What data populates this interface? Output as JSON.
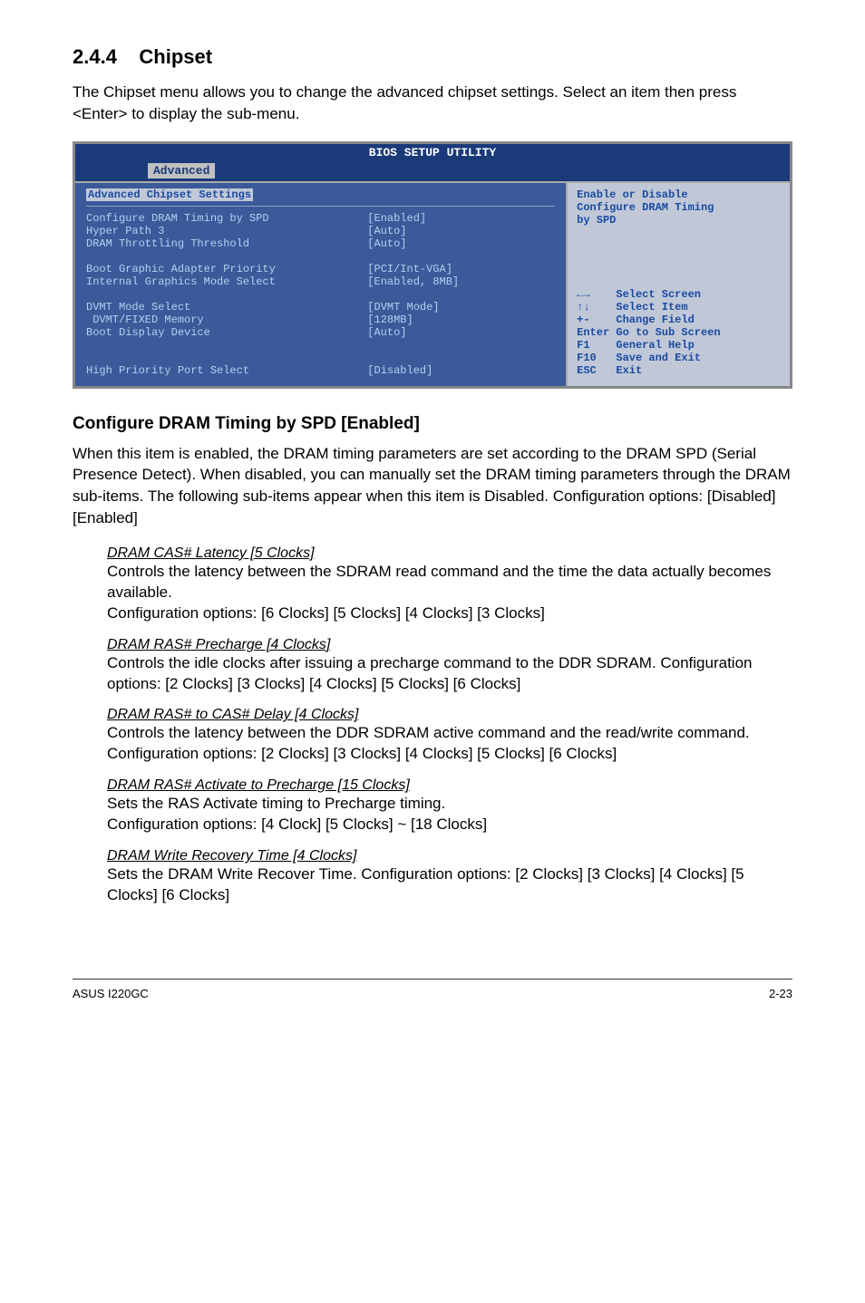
{
  "section": {
    "number": "2.4.4",
    "title": "Chipset",
    "description": "The Chipset menu allows you to change the advanced chipset settings. Select an item then press <Enter> to display the sub-menu."
  },
  "bios": {
    "title": "BIOS SETUP UTILITY",
    "activeTab": "Advanced",
    "panelHeading": "Advanced Chipset Settings",
    "rows": [
      {
        "label": "Configure DRAM Timing by SPD",
        "value": "[Enabled]"
      },
      {
        "label": "Hyper Path 3",
        "value": "[Auto]"
      },
      {
        "label": "DRAM Throttling Threshold",
        "value": "[Auto]"
      },
      {
        "label": "",
        "value": ""
      },
      {
        "label": "Boot Graphic Adapter Priority",
        "value": "[PCI/Int-VGA]"
      },
      {
        "label": "Internal Graphics Mode Select",
        "value": "[Enabled, 8MB]"
      },
      {
        "label": "",
        "value": ""
      },
      {
        "label": "DVMT Mode Select",
        "value": "[DVMT Mode]"
      },
      {
        "label": " DVMT/FIXED Memory",
        "value": "[128MB]"
      },
      {
        "label": "Boot Display Device",
        "value": "[Auto]"
      },
      {
        "label": "",
        "value": ""
      },
      {
        "label": "",
        "value": ""
      },
      {
        "label": "High Priority Port Select",
        "value": "[Disabled]"
      }
    ],
    "helpTop": {
      "line1": "Enable or Disable",
      "line2": "Configure DRAM Timing",
      "line3": "by SPD"
    },
    "helpBottom": [
      {
        "key": "←→",
        "action": "Select Screen"
      },
      {
        "key": "↑↓",
        "action": "Select Item"
      },
      {
        "key": "+-",
        "action": "Change Field"
      },
      {
        "key": "Enter",
        "action": "Go to Sub Screen"
      },
      {
        "key": "F1",
        "action": "General Help"
      },
      {
        "key": "F10",
        "action": "Save and Exit"
      },
      {
        "key": "ESC",
        "action": "Exit"
      }
    ]
  },
  "configDram": {
    "heading": "Configure DRAM Timing by SPD [Enabled]",
    "para": "When this item is enabled, the DRAM timing parameters are set according to the DRAM SPD (Serial Presence Detect). When disabled, you can manually set the DRAM timing parameters through the DRAM sub-items. The following sub-items appear when this item is Disabled. Configuration options: [Disabled] [Enabled]"
  },
  "subitems": [
    {
      "title": "DRAM CAS# Latency [5 Clocks]",
      "body": "Controls the latency between the SDRAM read command and the time the data actually becomes available.\nConfiguration options: [6 Clocks] [5 Clocks] [4 Clocks] [3 Clocks]"
    },
    {
      "title": "DRAM RAS# Precharge [4 Clocks]",
      "body": "Controls the idle clocks after issuing a precharge command to the DDR SDRAM. Configuration options: [2 Clocks] [3 Clocks] [4 Clocks] [5 Clocks] [6 Clocks]"
    },
    {
      "title": "DRAM RAS# to CAS# Delay [4 Clocks]",
      "body": "Controls the latency between the DDR SDRAM active command and the read/write command. Configuration options: [2 Clocks] [3 Clocks]  [4 Clocks] [5 Clocks] [6 Clocks]"
    },
    {
      "title": "DRAM RAS# Activate to Precharge [15 Clocks]",
      "body": "Sets the RAS Activate timing to Precharge timing.\nConfiguration options: [4 Clock] [5 Clocks] ~ [18 Clocks]"
    },
    {
      "title": "DRAM Write Recovery Time [4 Clocks]",
      "body": "Sets the DRAM Write Recover Time. Configuration options: [2 Clocks] [3 Clocks] [4 Clocks] [5 Clocks] [6 Clocks]"
    }
  ],
  "footer": {
    "left": "ASUS I220GC",
    "right": "2-23"
  }
}
